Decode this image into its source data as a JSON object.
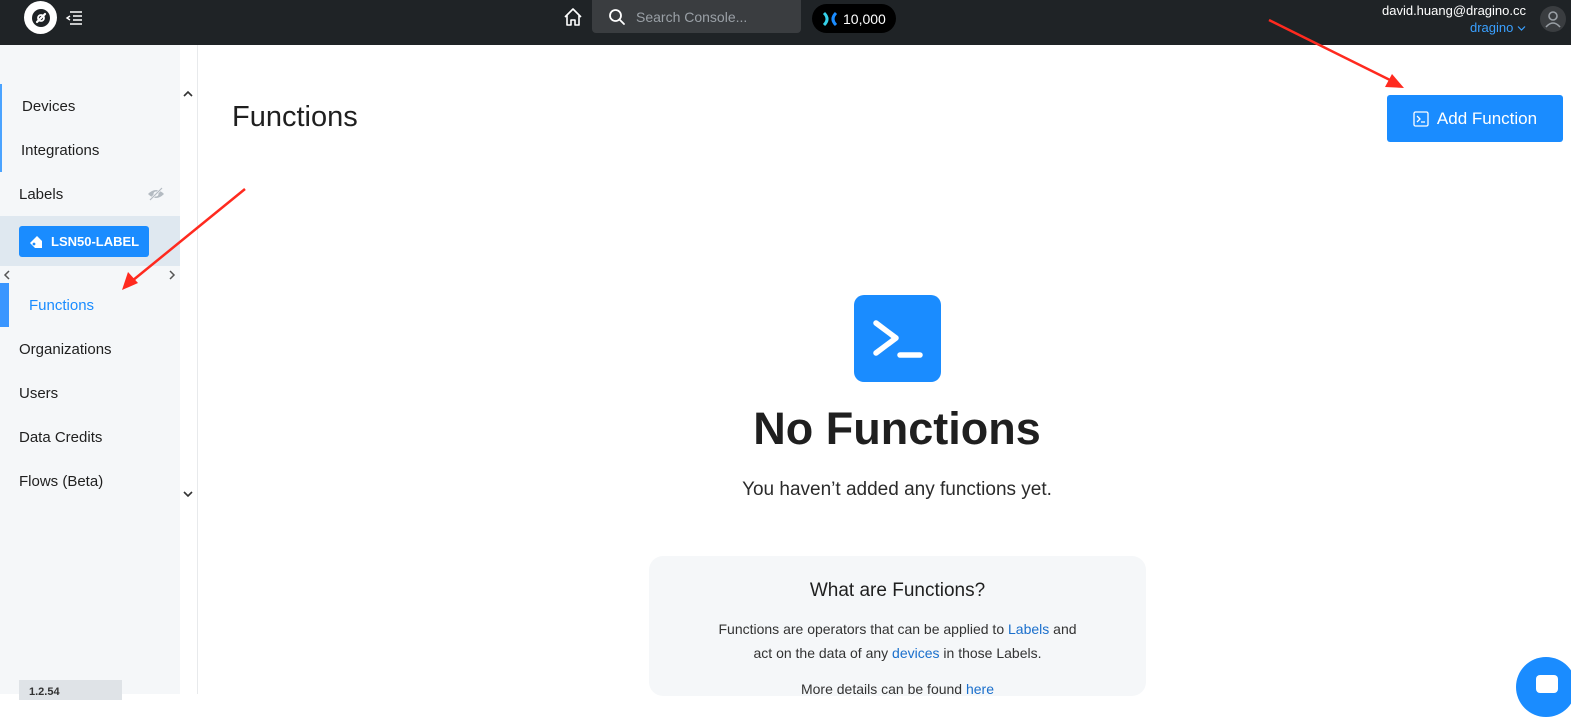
{
  "topbar": {
    "search_placeholder": "Search Console...",
    "credits": "10,000",
    "user_email": "david.huang@dragino.cc",
    "org": "dragino"
  },
  "sidebar": {
    "items": [
      {
        "label": "Devices"
      },
      {
        "label": "Integrations"
      },
      {
        "label": "Labels"
      },
      {
        "label": "Functions"
      },
      {
        "label": "Organizations"
      },
      {
        "label": "Users"
      },
      {
        "label": "Data Credits"
      },
      {
        "label": "Flows (Beta)"
      }
    ],
    "label_chip": "LSN50-LABEL",
    "version": "1.2.54"
  },
  "main": {
    "title": "Functions",
    "add_button": "Add Function",
    "empty_title": "No Functions",
    "empty_sub": "You haven’t added any functions yet.",
    "info": {
      "title": "What are Functions?",
      "line1_a": "Functions are operators that can be applied to ",
      "line1_link": "Labels",
      "line1_b": " and",
      "line2_a": "act on the data of any ",
      "line2_link": "devices",
      "line2_b": " in those Labels.",
      "line3_a": "More details can be found ",
      "line3_link": "here"
    }
  },
  "colors": {
    "accent": "#1a8cff",
    "topbar": "#1f2326",
    "sidebar_bg": "#f5f7f9",
    "arrow": "#ff2a1f"
  }
}
